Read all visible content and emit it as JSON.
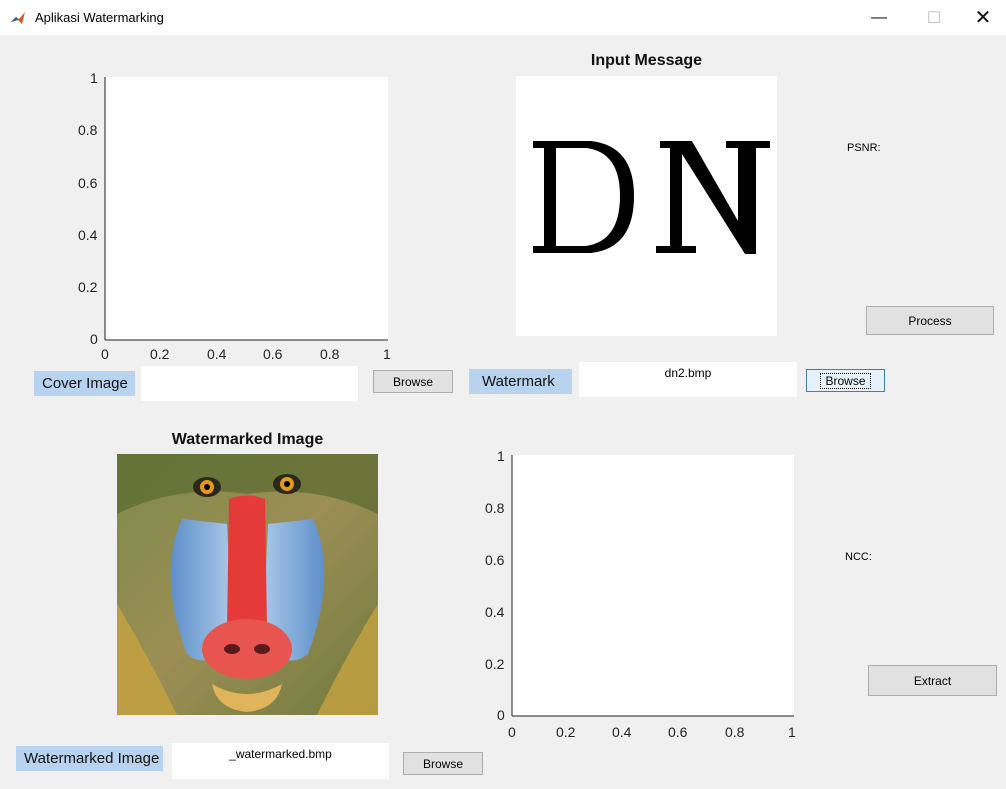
{
  "window": {
    "title": "Aplikasi Watermarking",
    "app_icon": "matlab-icon",
    "controls": [
      "minimize-icon",
      "maximize-icon",
      "close-icon"
    ]
  },
  "cover_axes": {
    "x_ticks": [
      "0",
      "0.2",
      "0.4",
      "0.6",
      "0.8",
      "1"
    ],
    "y_ticks": [
      "1",
      "0.8",
      "0.6",
      "0.4",
      "0.2",
      "0"
    ]
  },
  "extract_axes": {
    "x_ticks": [
      "0",
      "0.2",
      "0.4",
      "0.6",
      "0.8",
      "1"
    ],
    "y_ticks": [
      "1",
      "0.8",
      "0.6",
      "0.4",
      "0.2",
      "0"
    ]
  },
  "input_message": {
    "title": "Input Message",
    "image_text": "DN"
  },
  "watermarked_image": {
    "title": "Watermarked Image",
    "image_alt": "mandrill-image"
  },
  "cover": {
    "label": "Cover Image",
    "value": "",
    "browse_label": "Browse"
  },
  "watermark": {
    "label": "Watermark",
    "value": "dn2.bmp",
    "browse_label": "Browse"
  },
  "watermarked": {
    "label": "Watermarked Image",
    "value": "_watermarked.bmp",
    "browse_label": "Browse"
  },
  "metrics": {
    "psnr_label": "PSNR:",
    "ncc_label": "NCC:"
  },
  "actions": {
    "process_label": "Process",
    "extract_label": "Extract"
  },
  "colors": {
    "label_bg": "#b8d3ef",
    "window_bg": "#f0f0f0"
  }
}
